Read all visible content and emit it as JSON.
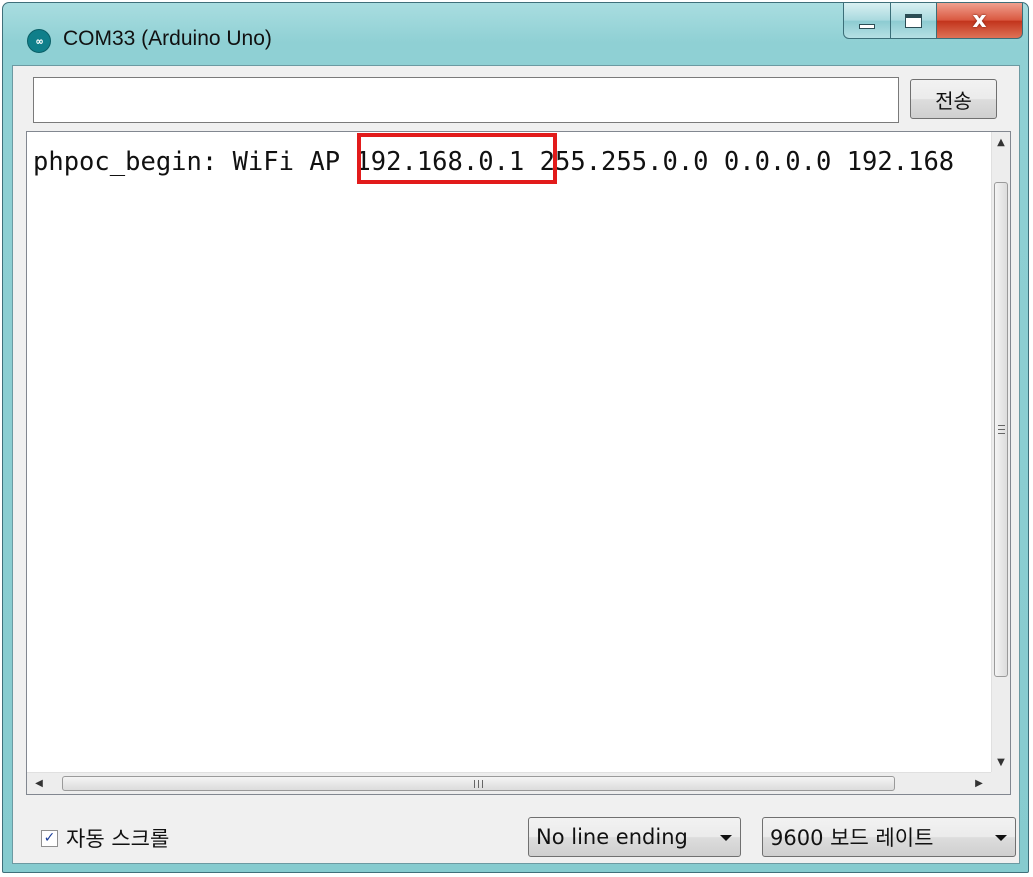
{
  "window": {
    "title": "COM33 (Arduino Uno)",
    "icon": "arduino-icon",
    "icon_glyph": "∞",
    "controls": {
      "minimize": "minimize-icon",
      "maximize": "maximize-icon",
      "close": "close-icon",
      "close_glyph": "x"
    }
  },
  "input": {
    "value": "",
    "placeholder": ""
  },
  "send_button": {
    "label": "전송"
  },
  "output": {
    "prefix": "phpoc_begin: WiFi AP ",
    "highlight": "192.168.0.1",
    "suffix": " 255.255.0.0 0.0.0.0 192.168",
    "highlight_color": "#e21b1b"
  },
  "scrollbars": {
    "up": "▲",
    "down": "▼",
    "left": "◀",
    "right": "▶"
  },
  "footer": {
    "autoscroll": {
      "label": "자동 스크롤",
      "checked": true,
      "check_glyph": "✓"
    },
    "line_ending": {
      "selected": "No line ending"
    },
    "baud_rate": {
      "selected": "9600 보드 레이트"
    }
  },
  "colors": {
    "titlebar": "#8fd0d4",
    "close_button": "#c2331b",
    "client_bg": "#f0f0f0"
  }
}
